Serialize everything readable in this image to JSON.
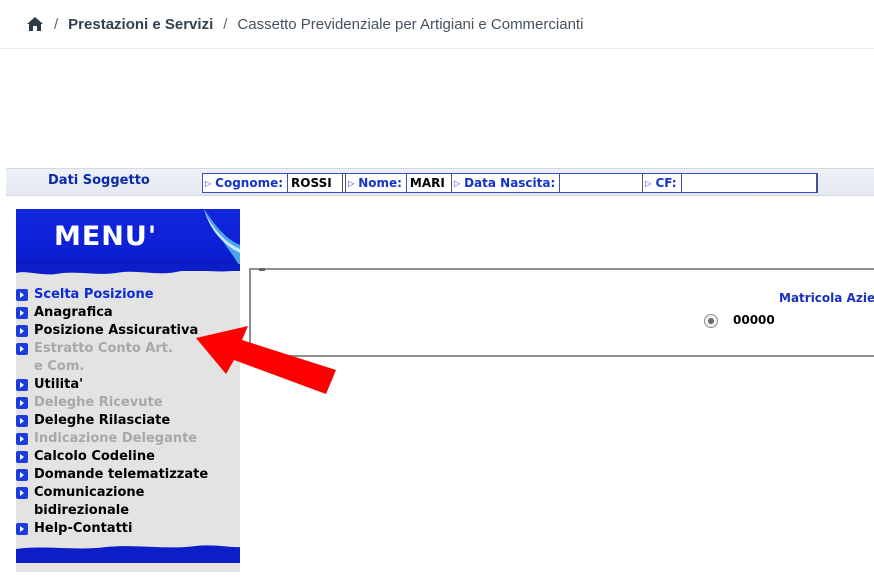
{
  "breadcrumb": {
    "home_icon": "home-icon",
    "sep1": "/",
    "section": "Prestazioni e Servizi",
    "sep2": "/",
    "current": "Cassetto Previdenziale per Artigiani e Commercianti"
  },
  "subject": {
    "title": "Dati Soggetto",
    "fields": [
      {
        "label": "Cognome:",
        "value": "ROSSI"
      },
      {
        "label": "Nome:",
        "value": "MARI"
      },
      {
        "label": "Data Nascita:",
        "value": ""
      },
      {
        "label": "CF:",
        "value": ""
      }
    ]
  },
  "menu": {
    "title": "MENU'",
    "items": [
      {
        "label": "Scelta Posizione",
        "state": "active"
      },
      {
        "label": "Anagrafica",
        "state": "on"
      },
      {
        "label": "Posizione Assicurativa",
        "state": "on"
      },
      {
        "label": "Estratto Conto Art. e Com.",
        "state": "off"
      },
      {
        "label": "Utilita'",
        "state": "on"
      },
      {
        "label": "Deleghe Ricevute",
        "state": "off"
      },
      {
        "label": "Deleghe Rilasciate",
        "state": "on"
      },
      {
        "label": "Indicazione Delegante",
        "state": "off"
      },
      {
        "label": "Calcolo Codeline",
        "state": "on"
      },
      {
        "label": "Domande telematizzate",
        "state": "on"
      },
      {
        "label": "Comunicazione bidirezionale",
        "state": "on"
      },
      {
        "label": "Help-Contatti",
        "state": "on"
      }
    ]
  },
  "panel": {
    "header": "Matricola Azie",
    "matricola": "00000",
    "radio_selected": true
  },
  "colors": {
    "menu_blue": "#0c1fd4",
    "link_blue": "#0c2bd6",
    "annotation_red": "#ff0000"
  }
}
